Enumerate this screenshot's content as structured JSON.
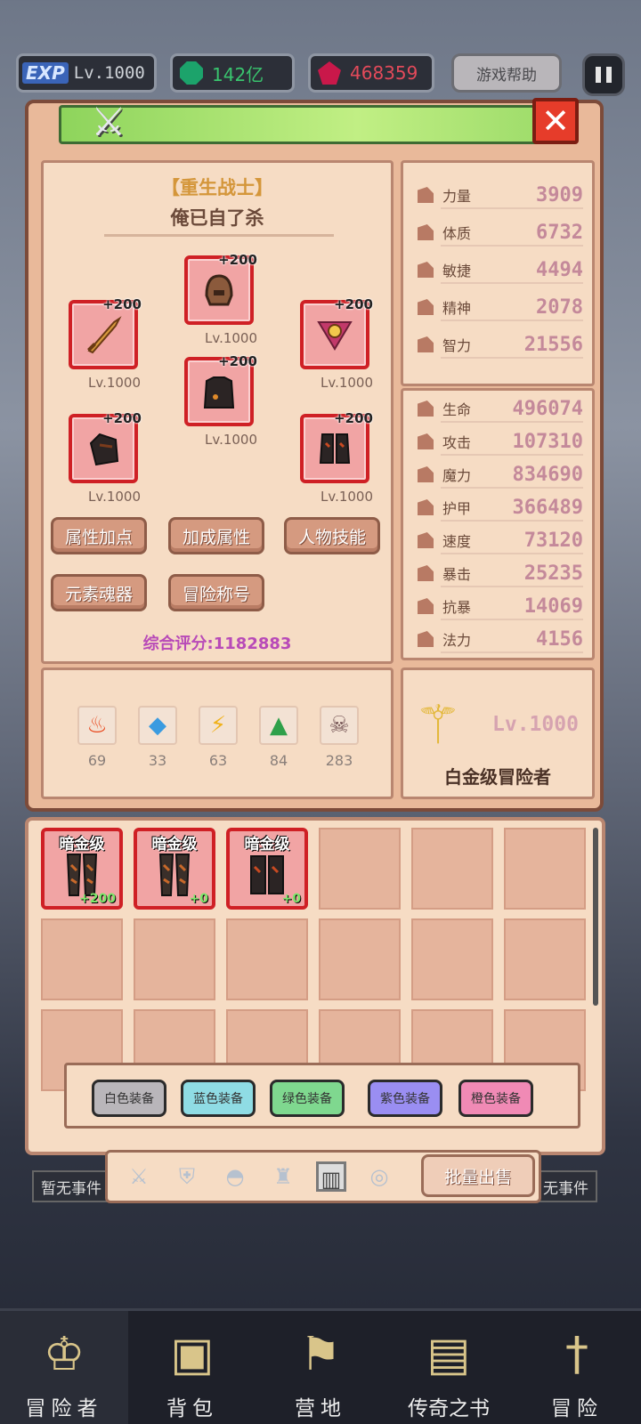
{
  "topbar": {
    "exp_tag": "EXP",
    "level": "Lv.1000",
    "gem1": "142亿",
    "gem2": "468359",
    "help": "游戏帮助"
  },
  "character": {
    "title": "【重生战士】",
    "name": "俺已自了杀",
    "slots": [
      {
        "plus": "+200",
        "level": "Lv.1000"
      },
      {
        "plus": "+200",
        "level": "Lv.1000"
      },
      {
        "plus": "+200",
        "level": "Lv.1000"
      },
      {
        "plus": "+200",
        "level": "Lv.1000"
      },
      {
        "plus": "+200",
        "level": "Lv.1000"
      },
      {
        "plus": "+200",
        "level": "Lv.1000"
      }
    ],
    "buttons": [
      "属性加点",
      "加成属性",
      "人物技能",
      "元素魂器",
      "冒险称号"
    ],
    "score": "综合评分:1182883"
  },
  "stats_basic": [
    {
      "name": "力量",
      "value": "3909"
    },
    {
      "name": "体质",
      "value": "6732"
    },
    {
      "name": "敏捷",
      "value": "4494"
    },
    {
      "name": "精神",
      "value": "2078"
    },
    {
      "name": "智力",
      "value": "21556"
    }
  ],
  "stats_combat": [
    {
      "name": "生命",
      "value": "496074"
    },
    {
      "name": "攻击",
      "value": "107310"
    },
    {
      "name": "魔力",
      "value": "834690"
    },
    {
      "name": "护甲",
      "value": "366489"
    },
    {
      "name": "速度",
      "value": "73120"
    },
    {
      "name": "暴击",
      "value": "25235"
    },
    {
      "name": "抗暴",
      "value": "14069"
    },
    {
      "name": "法力",
      "value": "4156"
    }
  ],
  "elements": [
    {
      "icon": "fire-element-icon",
      "count": "69"
    },
    {
      "icon": "water-element-icon",
      "count": "33"
    },
    {
      "icon": "lightning-element-icon",
      "count": "63"
    },
    {
      "icon": "earth-element-icon",
      "count": "84"
    },
    {
      "icon": "dark-element-icon",
      "count": "283"
    }
  ],
  "rank": {
    "level": "Lv.1000",
    "name": "白金级冒险者"
  },
  "inventory": [
    {
      "tier": "暗金级",
      "enhance": "+200"
    },
    {
      "tier": "暗金级",
      "enhance": "+0"
    },
    {
      "tier": "暗金级",
      "enhance": "+0"
    }
  ],
  "filters": [
    {
      "label": "白色装备",
      "color": "#b9b6ba"
    },
    {
      "label": "蓝色装备",
      "color": "#8fdce4"
    },
    {
      "label": "绿色装备",
      "color": "#7fd88f"
    },
    {
      "label": "紫色装备",
      "color": "#9a8ef2"
    },
    {
      "label": "橙色装备",
      "color": "#f08ab5"
    }
  ],
  "batch_sell": "批量出售",
  "side_tags": {
    "left": "暂无事件",
    "right": "无事件"
  },
  "nav": [
    "冒险者",
    "背包",
    "营地",
    "传奇之书",
    "冒险"
  ]
}
